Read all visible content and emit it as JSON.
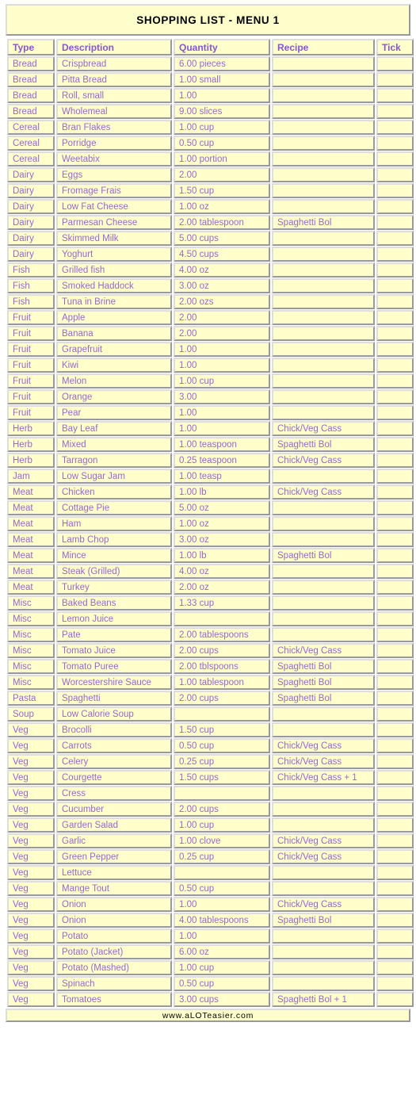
{
  "page": {
    "title": "SHOPPING LIST - MENU 1",
    "footer": "www.aLOTeasier.com",
    "accent_color": "#9966cc",
    "header_color": "#8855cc",
    "cell_background": "#ffffcc",
    "border_color": "#999999",
    "page_background": "#ffffff"
  },
  "table": {
    "columns": [
      {
        "key": "type",
        "label": "Type"
      },
      {
        "key": "desc",
        "label": "Description"
      },
      {
        "key": "qty",
        "label": "Quantity"
      },
      {
        "key": "recipe",
        "label": "Recipe"
      },
      {
        "key": "tick",
        "label": "Tick"
      }
    ],
    "rows": [
      {
        "type": "Bread",
        "desc": "Crispbread",
        "qty": "6.00 pieces",
        "recipe": "",
        "tick": ""
      },
      {
        "type": "Bread",
        "desc": "Pitta Bread",
        "qty": "1.00 small",
        "recipe": "",
        "tick": ""
      },
      {
        "type": "Bread",
        "desc": "Roll, small",
        "qty": "1.00",
        "recipe": "",
        "tick": ""
      },
      {
        "type": "Bread",
        "desc": "Wholemeal",
        "qty": "9.00 slices",
        "recipe": "",
        "tick": ""
      },
      {
        "type": "Cereal",
        "desc": "Bran Flakes",
        "qty": "1.00 cup",
        "recipe": "",
        "tick": ""
      },
      {
        "type": "Cereal",
        "desc": "Porridge",
        "qty": "0.50 cup",
        "recipe": "",
        "tick": ""
      },
      {
        "type": "Cereal",
        "desc": "Weetabix",
        "qty": "1.00 portion",
        "recipe": "",
        "tick": ""
      },
      {
        "type": "Dairy",
        "desc": "Eggs",
        "qty": "2.00",
        "recipe": "",
        "tick": ""
      },
      {
        "type": "Dairy",
        "desc": "Fromage Frais",
        "qty": "1.50 cup",
        "recipe": "",
        "tick": ""
      },
      {
        "type": "Dairy",
        "desc": "Low Fat Cheese",
        "qty": "1.00 oz",
        "recipe": "",
        "tick": ""
      },
      {
        "type": "Dairy",
        "desc": "Parmesan Cheese",
        "qty": "2.00 tablespoon",
        "recipe": "Spaghetti Bol",
        "tick": ""
      },
      {
        "type": "Dairy",
        "desc": "Skimmed Milk",
        "qty": "5.00 cups",
        "recipe": "",
        "tick": ""
      },
      {
        "type": "Dairy",
        "desc": "Yoghurt",
        "qty": "4.50 cups",
        "recipe": "",
        "tick": ""
      },
      {
        "type": "Fish",
        "desc": "Grilled fish",
        "qty": "4.00 oz",
        "recipe": "",
        "tick": ""
      },
      {
        "type": "Fish",
        "desc": "Smoked Haddock",
        "qty": "3.00 oz",
        "recipe": "",
        "tick": ""
      },
      {
        "type": "Fish",
        "desc": "Tuna in Brine",
        "qty": "2.00 ozs",
        "recipe": "",
        "tick": ""
      },
      {
        "type": "Fruit",
        "desc": "Apple",
        "qty": "2.00",
        "recipe": "",
        "tick": ""
      },
      {
        "type": "Fruit",
        "desc": "Banana",
        "qty": "2.00",
        "recipe": "",
        "tick": ""
      },
      {
        "type": "Fruit",
        "desc": "Grapefruit",
        "qty": "1.00",
        "recipe": "",
        "tick": ""
      },
      {
        "type": "Fruit",
        "desc": "Kiwi",
        "qty": "1.00",
        "recipe": "",
        "tick": ""
      },
      {
        "type": "Fruit",
        "desc": "Melon",
        "qty": "1.00 cup",
        "recipe": "",
        "tick": ""
      },
      {
        "type": "Fruit",
        "desc": "Orange",
        "qty": "3.00",
        "recipe": "",
        "tick": ""
      },
      {
        "type": "Fruit",
        "desc": "Pear",
        "qty": "1.00",
        "recipe": "",
        "tick": ""
      },
      {
        "type": "Herb",
        "desc": "Bay Leaf",
        "qty": "1.00",
        "recipe": "Chick/Veg Cass",
        "tick": ""
      },
      {
        "type": "Herb",
        "desc": "Mixed",
        "qty": "1.00 teaspoon",
        "recipe": "Spaghetti Bol",
        "tick": ""
      },
      {
        "type": "Herb",
        "desc": "Tarragon",
        "qty": "0.25 teaspoon",
        "recipe": "Chick/Veg Cass",
        "tick": ""
      },
      {
        "type": "Jam",
        "desc": "Low Sugar Jam",
        "qty": "1.00 teasp",
        "recipe": "",
        "tick": ""
      },
      {
        "type": "Meat",
        "desc": "Chicken",
        "qty": "1.00 lb",
        "recipe": "Chick/Veg Cass",
        "tick": ""
      },
      {
        "type": "Meat",
        "desc": "Cottage Pie",
        "qty": "5.00 oz",
        "recipe": "",
        "tick": ""
      },
      {
        "type": "Meat",
        "desc": "Ham",
        "qty": "1.00 oz",
        "recipe": "",
        "tick": ""
      },
      {
        "type": "Meat",
        "desc": "Lamb Chop",
        "qty": "3.00 oz",
        "recipe": "",
        "tick": ""
      },
      {
        "type": "Meat",
        "desc": "Mince",
        "qty": "1.00 lb",
        "recipe": "Spaghetti Bol",
        "tick": ""
      },
      {
        "type": "Meat",
        "desc": "Steak (Grilled)",
        "qty": "4.00 oz",
        "recipe": "",
        "tick": ""
      },
      {
        "type": "Meat",
        "desc": "Turkey",
        "qty": "2.00 oz",
        "recipe": "",
        "tick": ""
      },
      {
        "type": "Misc",
        "desc": "Baked Beans",
        "qty": "1.33 cup",
        "recipe": "",
        "tick": ""
      },
      {
        "type": "Misc",
        "desc": "Lemon Juice",
        "qty": "",
        "recipe": "",
        "tick": ""
      },
      {
        "type": "Misc",
        "desc": "Pate",
        "qty": "2.00 tablespoons",
        "recipe": "",
        "tick": ""
      },
      {
        "type": "Misc",
        "desc": "Tomato Juice",
        "qty": "2.00 cups",
        "recipe": "Chick/Veg Cass",
        "tick": ""
      },
      {
        "type": "Misc",
        "desc": "Tomato Puree",
        "qty": "2.00 tblspoons",
        "recipe": "Spaghetti Bol",
        "tick": ""
      },
      {
        "type": "Misc",
        "desc": "Worcestershire Sauce",
        "qty": "1.00 tablespoon",
        "recipe": "Spaghetti Bol",
        "tick": ""
      },
      {
        "type": "Pasta",
        "desc": "Spaghetti",
        "qty": "2.00 cups",
        "recipe": "Spaghetti Bol",
        "tick": ""
      },
      {
        "type": "Soup",
        "desc": "Low Calorie Soup",
        "qty": "",
        "recipe": "",
        "tick": ""
      },
      {
        "type": "Veg",
        "desc": "Brocolli",
        "qty": "1.50 cup",
        "recipe": "",
        "tick": ""
      },
      {
        "type": "Veg",
        "desc": "Carrots",
        "qty": "0.50 cup",
        "recipe": "Chick/Veg Cass",
        "tick": ""
      },
      {
        "type": "Veg",
        "desc": "Celery",
        "qty": "0.25 cup",
        "recipe": "Chick/Veg Cass",
        "tick": ""
      },
      {
        "type": "Veg",
        "desc": "Courgette",
        "qty": "1.50 cups",
        "recipe": "Chick/Veg Cass + 1",
        "tick": ""
      },
      {
        "type": "Veg",
        "desc": "Cress",
        "qty": "",
        "recipe": "",
        "tick": ""
      },
      {
        "type": "Veg",
        "desc": "Cucumber",
        "qty": "2.00 cups",
        "recipe": "",
        "tick": ""
      },
      {
        "type": "Veg",
        "desc": "Garden Salad",
        "qty": "1.00 cup",
        "recipe": "",
        "tick": ""
      },
      {
        "type": "Veg",
        "desc": "Garlic",
        "qty": "1.00 clove",
        "recipe": "Chick/Veg Cass",
        "tick": ""
      },
      {
        "type": "Veg",
        "desc": "Green Pepper",
        "qty": "0.25 cup",
        "recipe": "Chick/Veg Cass",
        "tick": ""
      },
      {
        "type": "Veg",
        "desc": "Lettuce",
        "qty": "",
        "recipe": "",
        "tick": ""
      },
      {
        "type": "Veg",
        "desc": "Mange Tout",
        "qty": "0.50 cup",
        "recipe": "",
        "tick": ""
      },
      {
        "type": "Veg",
        "desc": "Onion",
        "qty": "1.00",
        "recipe": "Chick/Veg Cass",
        "tick": ""
      },
      {
        "type": "Veg",
        "desc": "Onion",
        "qty": "4.00 tablespoons",
        "recipe": "Spaghetti Bol",
        "tick": ""
      },
      {
        "type": "Veg",
        "desc": "Potato",
        "qty": "1.00",
        "recipe": "",
        "tick": ""
      },
      {
        "type": "Veg",
        "desc": "Potato (Jacket)",
        "qty": "6.00 oz",
        "recipe": "",
        "tick": ""
      },
      {
        "type": "Veg",
        "desc": "Potato (Mashed)",
        "qty": "1.00 cup",
        "recipe": "",
        "tick": ""
      },
      {
        "type": "Veg",
        "desc": "Spinach",
        "qty": "0.50 cup",
        "recipe": "",
        "tick": ""
      },
      {
        "type": "Veg",
        "desc": "Tomatoes",
        "qty": "3.00 cups",
        "recipe": "Spaghetti Bol + 1",
        "tick": ""
      }
    ]
  }
}
